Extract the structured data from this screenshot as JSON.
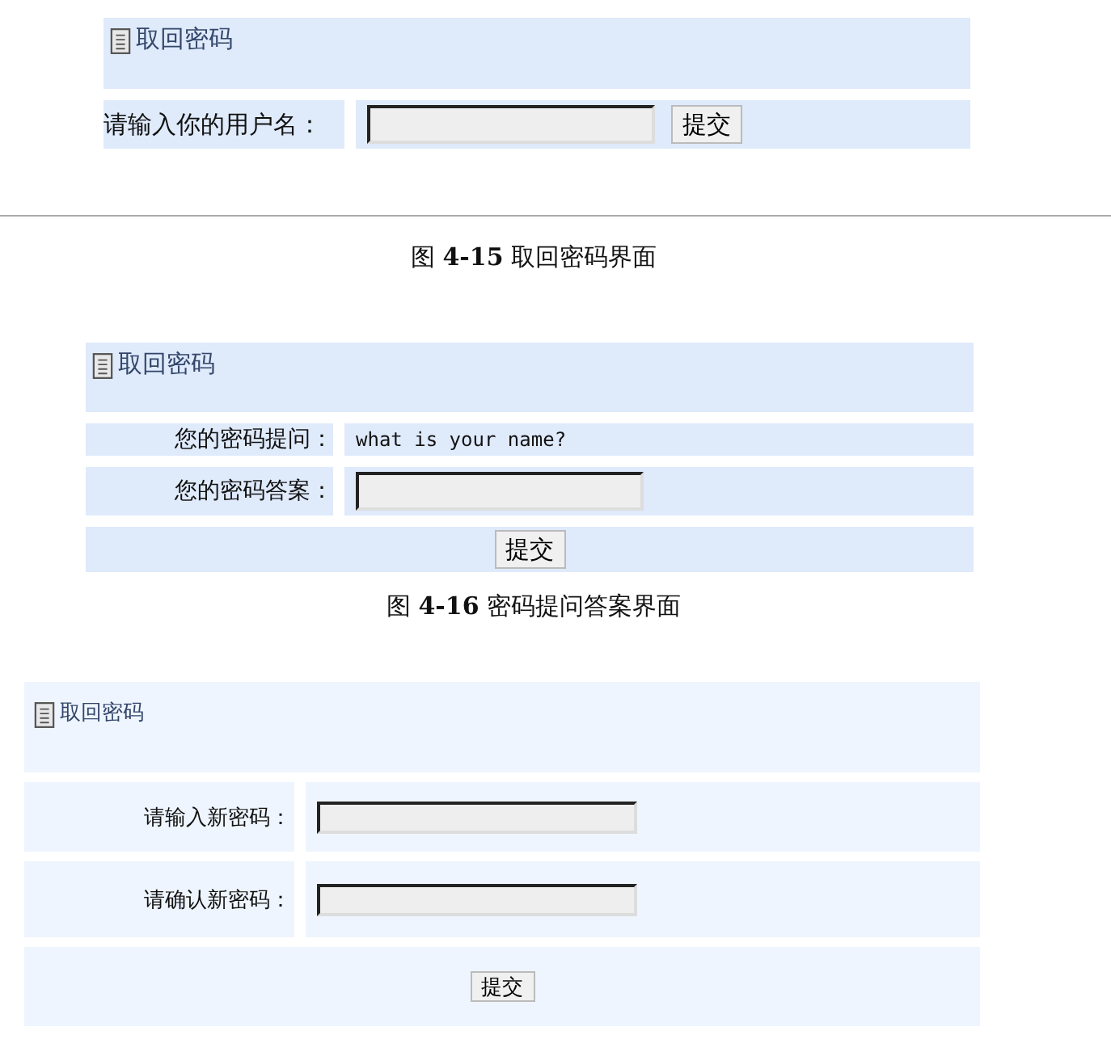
{
  "figures": [
    {
      "panel": {
        "title": "取回密码",
        "rows": [
          {
            "kind": "input_button",
            "label": "请输入你的用户名：",
            "button": "提交"
          }
        ]
      },
      "caption": "图 **4-15**  取回密码界面"
    },
    {
      "panel": {
        "title": "取回密码",
        "rows": [
          {
            "kind": "text",
            "label": "您的密码提问：",
            "value": "what is your name?"
          },
          {
            "kind": "input",
            "label": "您的密码答案："
          },
          {
            "kind": "button",
            "button": "提交"
          }
        ]
      },
      "caption": "图 **4-16**  密码提问答案界面"
    },
    {
      "panel": {
        "title": "取回密码",
        "rows": [
          {
            "kind": "input",
            "label": "请输入新密码："
          },
          {
            "kind": "input",
            "label": "请确认新密码："
          },
          {
            "kind": "button",
            "button": "提交"
          }
        ]
      }
    }
  ]
}
